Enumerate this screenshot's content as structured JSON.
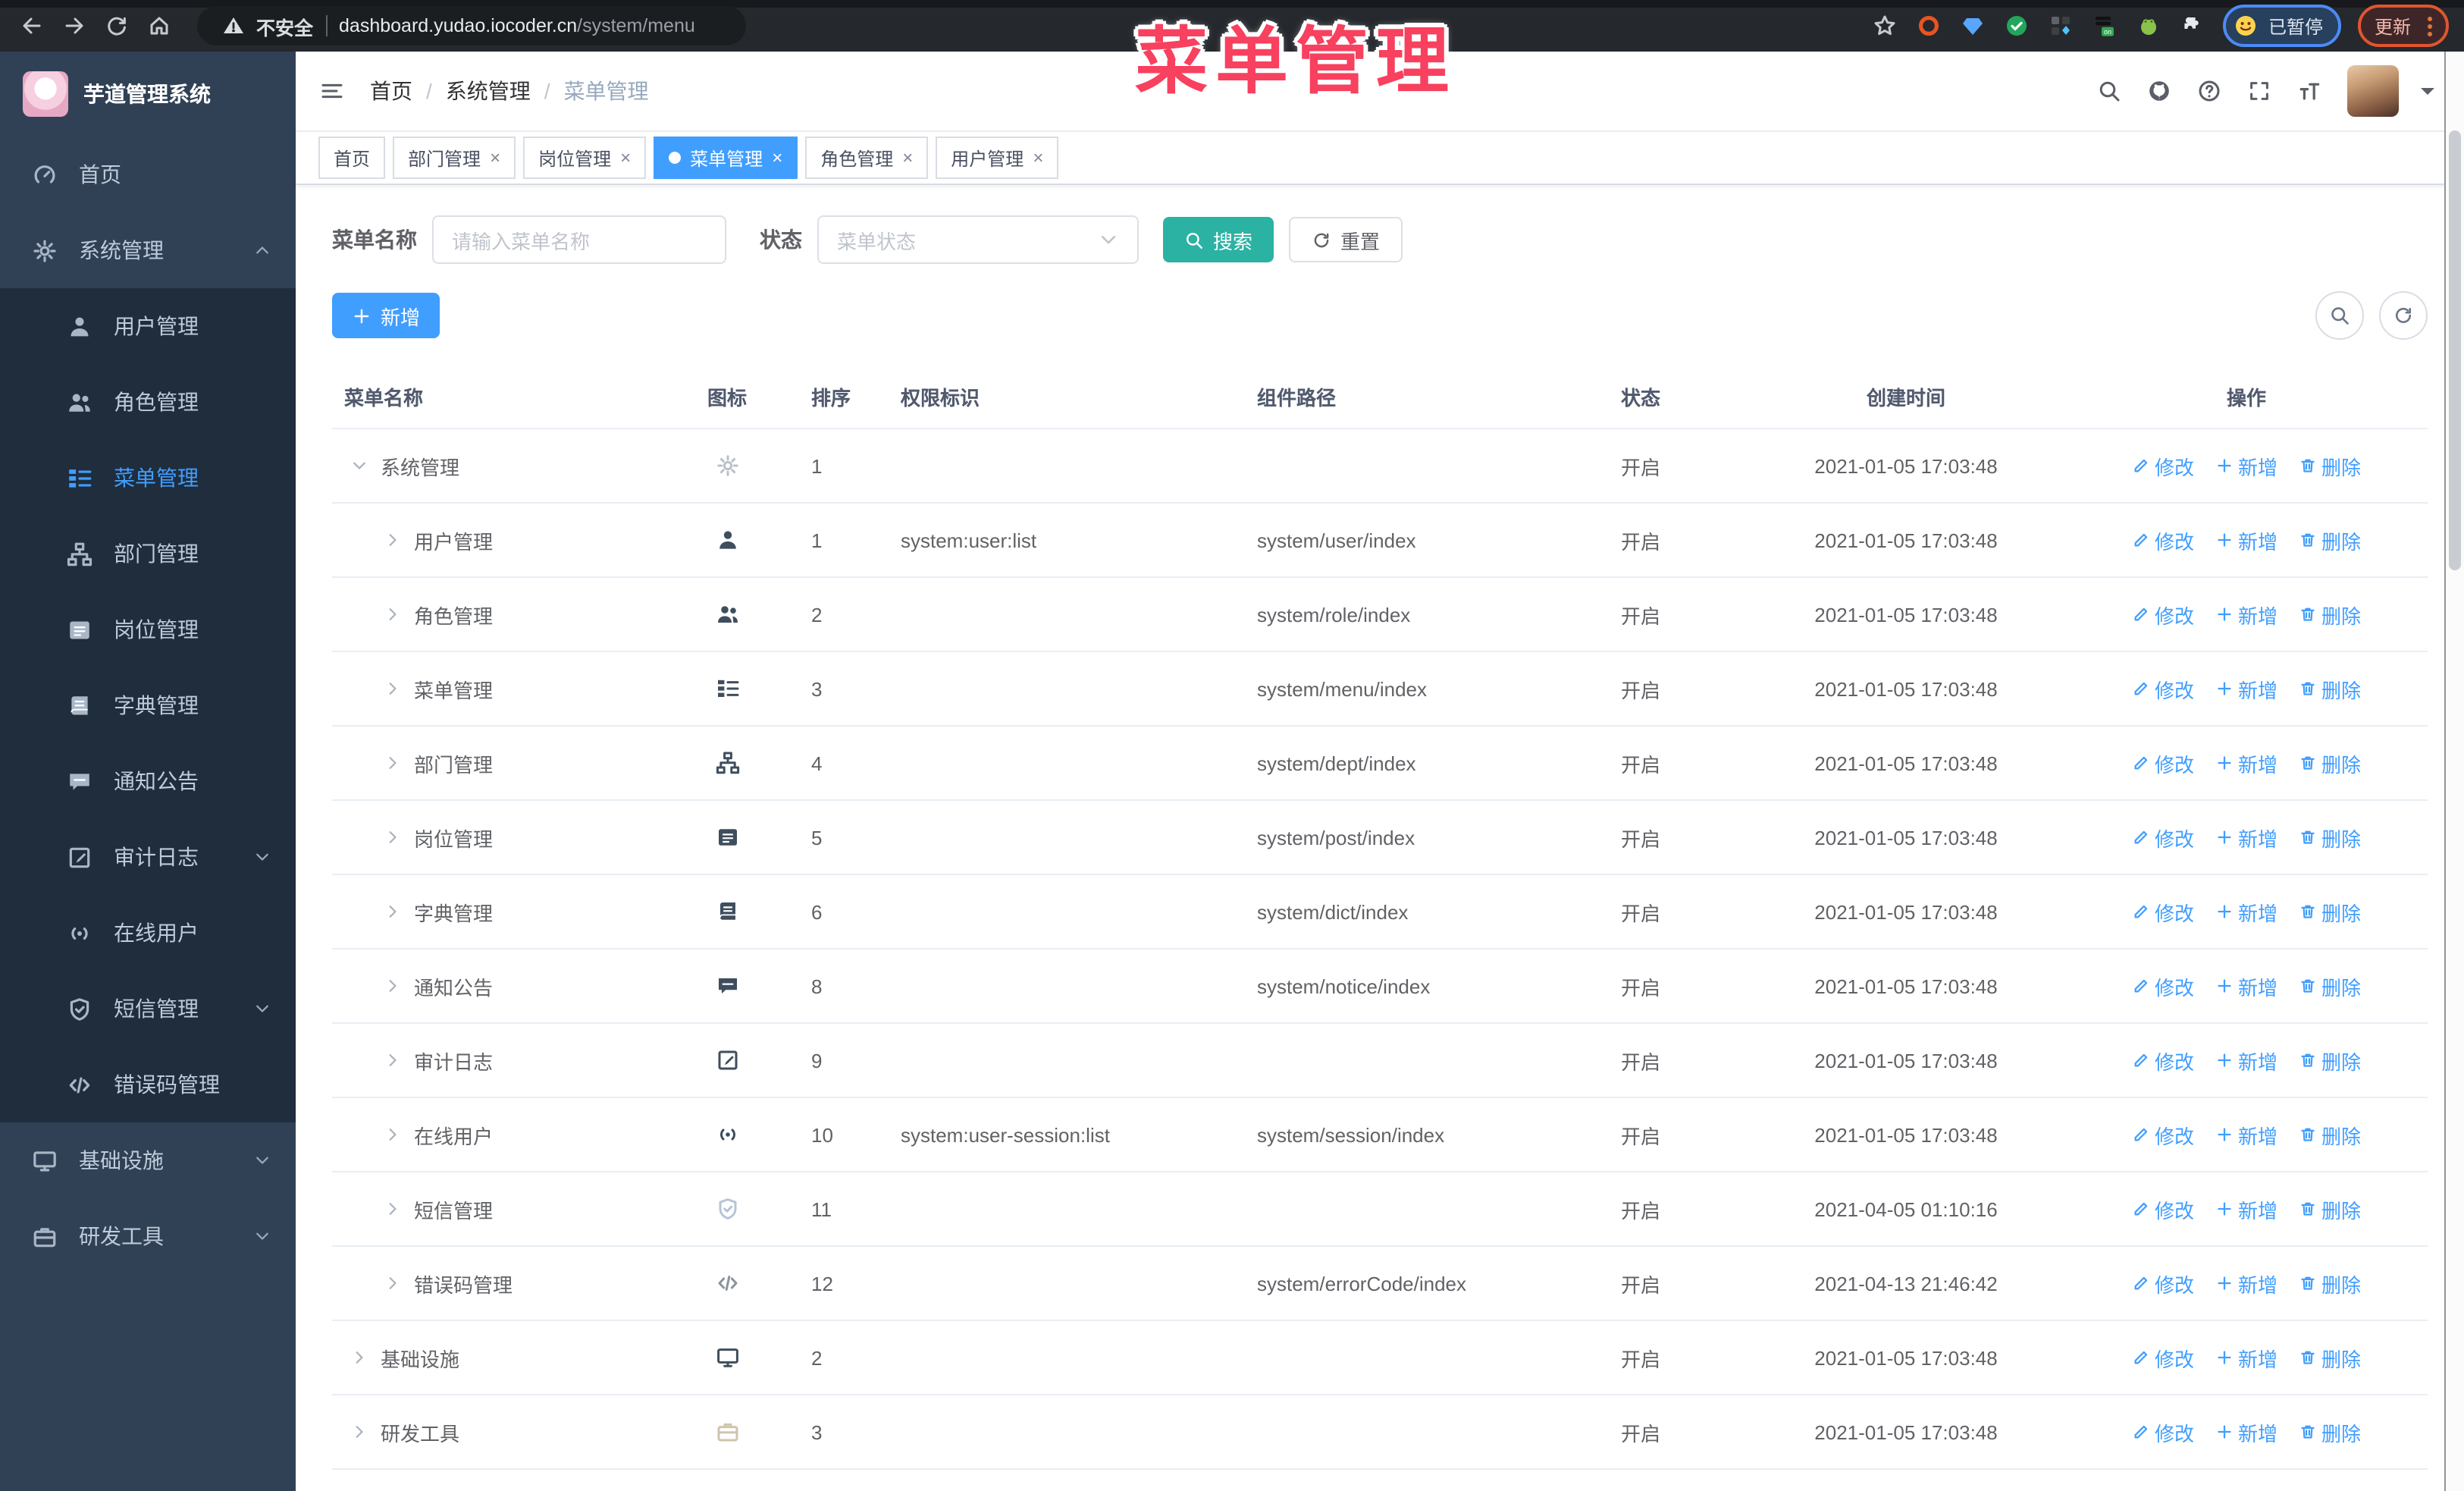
{
  "overlay": {
    "title": "菜单管理"
  },
  "browser": {
    "security_label": "不安全",
    "url_host": "dashboard.yudao.iocoder.cn",
    "url_path": "/system/menu",
    "paused_badge": "已暂停",
    "update_button": "更新"
  },
  "sidebar": {
    "logo_title": "芋道管理系统",
    "items": [
      {
        "label": "首页",
        "icon": "dashboard-icon",
        "type": "top"
      },
      {
        "label": "系统管理",
        "icon": "gear-icon",
        "type": "top",
        "arrow": "up"
      },
      {
        "label": "用户管理",
        "icon": "user-icon",
        "type": "sub"
      },
      {
        "label": "角色管理",
        "icon": "users-icon",
        "type": "sub"
      },
      {
        "label": "菜单管理",
        "icon": "tree-table-icon",
        "type": "sub",
        "active": true
      },
      {
        "label": "部门管理",
        "icon": "tree-icon",
        "type": "sub"
      },
      {
        "label": "岗位管理",
        "icon": "post-icon",
        "type": "sub"
      },
      {
        "label": "字典管理",
        "icon": "dict-icon",
        "type": "sub"
      },
      {
        "label": "通知公告",
        "icon": "message-icon",
        "type": "sub"
      },
      {
        "label": "审计日志",
        "icon": "log-icon",
        "type": "sub",
        "arrow": "down"
      },
      {
        "label": "在线用户",
        "icon": "online-icon",
        "type": "sub"
      },
      {
        "label": "短信管理",
        "icon": "shield-icon",
        "type": "sub",
        "arrow": "down"
      },
      {
        "label": "错误码管理",
        "icon": "code-icon",
        "type": "sub"
      },
      {
        "label": "基础设施",
        "icon": "monitor-icon",
        "type": "top",
        "arrow": "down"
      },
      {
        "label": "研发工具",
        "icon": "tool-icon",
        "type": "top",
        "arrow": "down"
      }
    ]
  },
  "header": {
    "breadcrumb": [
      "首页",
      "系统管理",
      "菜单管理"
    ]
  },
  "tabs": [
    {
      "label": "首页",
      "closable": false,
      "active": false
    },
    {
      "label": "部门管理",
      "closable": true,
      "active": false
    },
    {
      "label": "岗位管理",
      "closable": true,
      "active": false
    },
    {
      "label": "菜单管理",
      "closable": true,
      "active": true
    },
    {
      "label": "角色管理",
      "closable": true,
      "active": false
    },
    {
      "label": "用户管理",
      "closable": true,
      "active": false
    }
  ],
  "filters": {
    "name_label": "菜单名称",
    "name_placeholder": "请输入菜单名称",
    "status_label": "状态",
    "status_placeholder": "菜单状态",
    "search_label": "搜索",
    "reset_label": "重置"
  },
  "toolbar": {
    "add_label": "新增"
  },
  "colors": {
    "accent_blue": "#409eff",
    "search_teal": "#2bb2a3",
    "overlay_pink": "#f8405f",
    "sidebar_bg": "#304156",
    "sidebar_sub_bg": "#1f2d3d"
  },
  "table": {
    "columns": [
      "菜单名称",
      "图标",
      "排序",
      "权限标识",
      "组件路径",
      "状态",
      "创建时间",
      "操作"
    ],
    "actions": {
      "edit": "修改",
      "add": "新增",
      "delete": "删除"
    },
    "rows": [
      {
        "name": "系统管理",
        "level": 0,
        "caret": "down",
        "icon": "gear-icon",
        "sort": "1",
        "perms": "",
        "path": "",
        "status": "开启",
        "time": "2021-01-05 17:03:48"
      },
      {
        "name": "用户管理",
        "level": 1,
        "caret": "right",
        "icon": "user-icon",
        "sort": "1",
        "perms": "system:user:list",
        "path": "system/user/index",
        "status": "开启",
        "time": "2021-01-05 17:03:48"
      },
      {
        "name": "角色管理",
        "level": 1,
        "caret": "right",
        "icon": "users-icon",
        "sort": "2",
        "perms": "",
        "path": "system/role/index",
        "status": "开启",
        "time": "2021-01-05 17:03:48"
      },
      {
        "name": "菜单管理",
        "level": 1,
        "caret": "right",
        "icon": "tree-table-icon",
        "sort": "3",
        "perms": "",
        "path": "system/menu/index",
        "status": "开启",
        "time": "2021-01-05 17:03:48"
      },
      {
        "name": "部门管理",
        "level": 1,
        "caret": "right",
        "icon": "tree-icon",
        "sort": "4",
        "perms": "",
        "path": "system/dept/index",
        "status": "开启",
        "time": "2021-01-05 17:03:48"
      },
      {
        "name": "岗位管理",
        "level": 1,
        "caret": "right",
        "icon": "post-icon",
        "sort": "5",
        "perms": "",
        "path": "system/post/index",
        "status": "开启",
        "time": "2021-01-05 17:03:48"
      },
      {
        "name": "字典管理",
        "level": 1,
        "caret": "right",
        "icon": "dict-icon",
        "sort": "6",
        "perms": "",
        "path": "system/dict/index",
        "status": "开启",
        "time": "2021-01-05 17:03:48"
      },
      {
        "name": "通知公告",
        "level": 1,
        "caret": "right",
        "icon": "message-icon",
        "sort": "8",
        "perms": "",
        "path": "system/notice/index",
        "status": "开启",
        "time": "2021-01-05 17:03:48"
      },
      {
        "name": "审计日志",
        "level": 1,
        "caret": "right",
        "icon": "log-icon",
        "sort": "9",
        "perms": "",
        "path": "",
        "status": "开启",
        "time": "2021-01-05 17:03:48"
      },
      {
        "name": "在线用户",
        "level": 1,
        "caret": "right",
        "icon": "online-icon",
        "sort": "10",
        "perms": "system:user-session:list",
        "path": "system/session/index",
        "status": "开启",
        "time": "2021-01-05 17:03:48"
      },
      {
        "name": "短信管理",
        "level": 1,
        "caret": "right",
        "icon": "shield-icon",
        "sort": "11",
        "perms": "",
        "path": "",
        "status": "开启",
        "time": "2021-04-05 01:10:16"
      },
      {
        "name": "错误码管理",
        "level": 1,
        "caret": "right",
        "icon": "code-icon",
        "sort": "12",
        "perms": "",
        "path": "system/errorCode/index",
        "status": "开启",
        "time": "2021-04-13 21:46:42"
      },
      {
        "name": "基础设施",
        "level": 0,
        "caret": "right",
        "icon": "monitor-icon",
        "sort": "2",
        "perms": "",
        "path": "",
        "status": "开启",
        "time": "2021-01-05 17:03:48"
      },
      {
        "name": "研发工具",
        "level": 0,
        "caret": "right",
        "icon": "tool-icon",
        "sort": "3",
        "perms": "",
        "path": "",
        "status": "开启",
        "time": "2021-01-05 17:03:48"
      }
    ]
  }
}
